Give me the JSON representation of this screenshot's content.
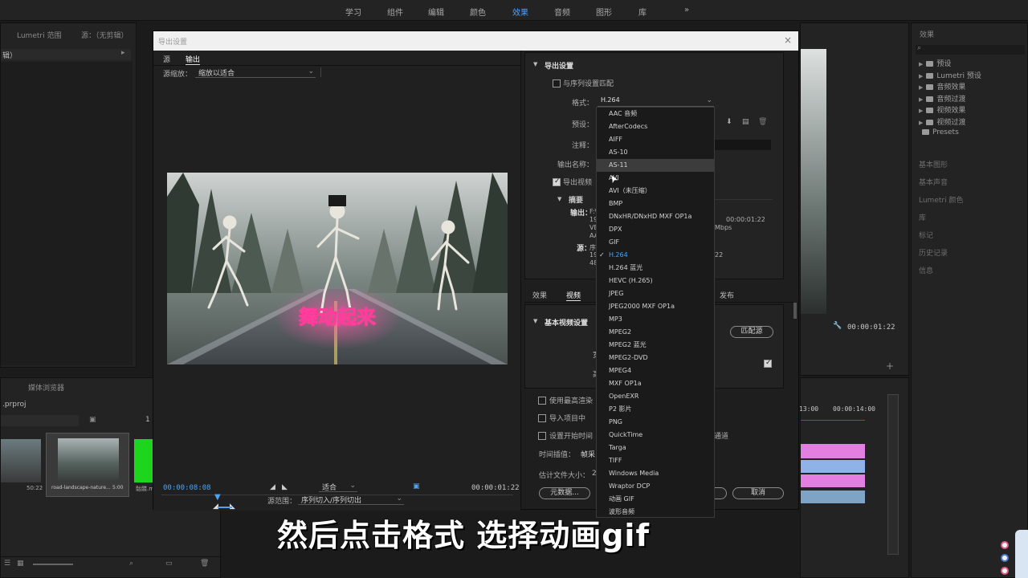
{
  "workspace_tabs": [
    {
      "label": "学习"
    },
    {
      "label": "组件"
    },
    {
      "label": "编辑"
    },
    {
      "label": "颜色"
    },
    {
      "label": "效果"
    },
    {
      "label": "音频"
    },
    {
      "label": "图形"
    },
    {
      "label": "库"
    }
  ],
  "workspace_more": "»",
  "left_panel": {
    "tab1": "Lumetri 范围",
    "tab2": "源：（无剪辑）",
    "bin_label": "辑）"
  },
  "project_panel": {
    "tab1": "媒体浏览器",
    "file": ".prproj",
    "count": "1",
    "clip1_dur": "50:22",
    "clip2_name": "road-landscape-nature...",
    "clip2_dur": "5:00",
    "clip3_name": "骷髅.m"
  },
  "effects_panel": {
    "title": "效果",
    "search_placeholder": "",
    "items": [
      "预设",
      "Lumetri 预设",
      "音频效果",
      "音频过渡",
      "视频效果",
      "视频过渡",
      "Presets"
    ],
    "sections": [
      "基本图形",
      "基本声音",
      "Lumetri 颜色",
      "库",
      "标记",
      "历史记录",
      "信息"
    ]
  },
  "program": {
    "timecode": "00:00:01:22",
    "ruler1": "13:00",
    "ruler2": "00:00:14:00"
  },
  "dialog": {
    "title": "导出设置",
    "close": "×",
    "tabs": [
      "源",
      "输出"
    ],
    "source_scaling_label": "源缩放：",
    "source_scaling_value": "缩放以适合",
    "frame_caption": "舞动起来",
    "current_tc": "00:00:08:08",
    "fit_value": "适合",
    "end_tc": "00:00:01:22",
    "source_range_label": "源范围：",
    "source_range_value": "序列切入/序列切出",
    "export_settings": {
      "header": "导出设置",
      "match_sequence": "与序列设置匹配",
      "format_label": "格式：",
      "format_value": "H.264",
      "preset_label": "预设：",
      "comment_label": "注释：",
      "output_name_label": "输出名称：",
      "export_video": "导出视频",
      "summary_label": "摘要",
      "output_label": "输出：",
      "output_lines": [
        "F:\\",
        "19",
        "VB",
        "AA"
      ],
      "output_tc": "00:00:01:22",
      "output_bitrate": "Mbps",
      "source_label": "源：",
      "source_lines": [
        "序",
        "19",
        "48"
      ],
      "source_tc": "22"
    },
    "bottom_tabs": [
      "效果",
      "视频",
      "发布"
    ],
    "basic_video": "基本视频设置",
    "match_source": "匹配源",
    "wide_label": "宽",
    "high_label": "高",
    "use_max_render": "使用最高渲染",
    "import_project": "导入项目中",
    "set_start_time": "设置开始时间",
    "channel": "通道",
    "time_interp_label": "时间插值：",
    "time_interp_value": "帧采",
    "est_size_label": "估计文件大小：",
    "est_size_value": "2",
    "metadata_btn": "元数据...",
    "cancel_btn": "取消"
  },
  "format_dropdown": {
    "items": [
      "AAC 音频",
      "AfterCodecs",
      "AIFF",
      "AS-10",
      "AS-11",
      "AVI",
      "AVI（未压缩）",
      "BMP",
      "DNxHR/DNxHD MXF OP1a",
      "DPX",
      "GIF",
      "H.264",
      "H.264 蓝光",
      "HEVC (H.265)",
      "JPEG",
      "JPEG2000 MXF OP1a",
      "MP3",
      "MPEG2",
      "MPEG2 蓝光",
      "MPEG2-DVD",
      "MPEG4",
      "MXF OP1a",
      "OpenEXR",
      "P2 影片",
      "PNG",
      "QuickTime",
      "Targa",
      "TIFF",
      "Windows Media",
      "Wraptor DCP",
      "动画 GIF",
      "波形音频"
    ],
    "hover_index": 4,
    "selected_index": 11
  },
  "subtitle": "然后点击格式  选择动画gif",
  "colors": {
    "accent": "#4ea3f2",
    "timeline_pink": "#e37fe0",
    "timeline_blue": "#8fb3e8"
  }
}
